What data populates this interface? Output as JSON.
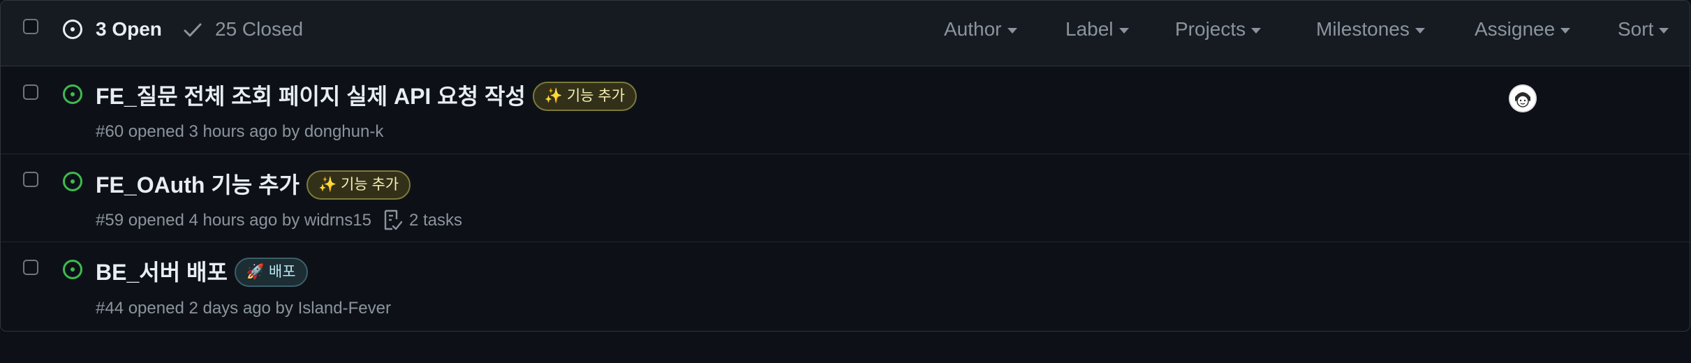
{
  "header": {
    "open_label": "3 Open",
    "closed_label": "25 Closed",
    "filters": [
      "Author",
      "Label",
      "Projects",
      "Milestones",
      "Assignee",
      "Sort"
    ]
  },
  "issues": [
    {
      "title": "FE_질문 전체 조회 페이지 실제 API 요청 작성",
      "label": "✨ 기능 추가",
      "label_colors": {
        "bg": "#33301a",
        "border": "#7d7a3a",
        "text": "#f5f0b0"
      },
      "meta": "#60 opened 3 hours ago by donghun-k",
      "tasks": "",
      "has_assignee_avatar": true
    },
    {
      "title": "FE_OAuth 기능 추가",
      "label": "✨ 기능 추가",
      "label_colors": {
        "bg": "#33301a",
        "border": "#7d7a3a",
        "text": "#f5f0b0"
      },
      "meta": "#59 opened 4 hours ago by widrns15",
      "tasks": "2 tasks",
      "has_assignee_avatar": false
    },
    {
      "title": "BE_서버 배포",
      "label": "🚀 배포",
      "label_colors": {
        "bg": "#1c2d33",
        "border": "#3b5f6a",
        "text": "#b8e6f2"
      },
      "meta": "#44 opened 2 days ago by Island-Fever",
      "tasks": "",
      "has_assignee_avatar": false
    }
  ],
  "colors": {
    "background": "#0d1117",
    "header_bg": "#161b22",
    "open_green": "#3fb950",
    "muted_text": "#8b949e"
  }
}
